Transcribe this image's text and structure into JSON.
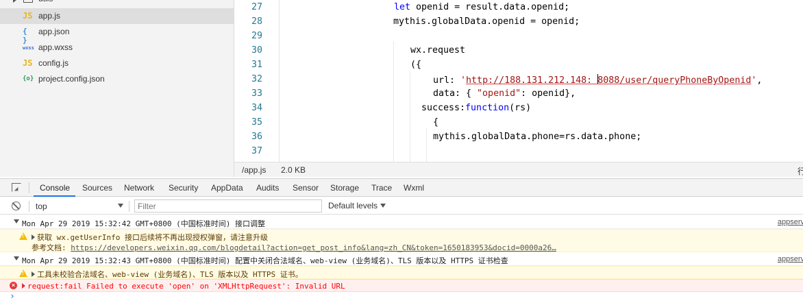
{
  "filetree": {
    "folder": {
      "label": "utils",
      "icon": "folder-icon"
    },
    "files": [
      {
        "name": "app.js",
        "icon": "JS",
        "type": "js",
        "active": true
      },
      {
        "name": "app.json",
        "icon": "{ }",
        "type": "json",
        "active": false
      },
      {
        "name": "app.wxss",
        "icon": "wxss",
        "type": "wxss",
        "active": false
      },
      {
        "name": "config.js",
        "icon": "JS",
        "type": "js",
        "active": false
      },
      {
        "name": "project.config.json",
        "icon": "{o}",
        "type": "cfg",
        "active": false
      }
    ]
  },
  "editor": {
    "line_numbers": [
      "27",
      "28",
      "29",
      "30",
      "31",
      "32",
      "33",
      "34",
      "35",
      "36",
      "37"
    ],
    "lines": {
      "l27_kw": "let",
      "l27_rest": " openid = result.data.openid;",
      "l28": "mythis.globalData.openid = openid;",
      "l30": "wx.request",
      "l31": "({",
      "l32_key": "url: ",
      "l32_q1": "'",
      "l32_url_a": "http://188.131.212.148: ",
      "l32_url_b": "8088/user/queryPhoneByOpenid",
      "l32_q2": "'",
      "l32_tail": ",",
      "l33_a": "data: { ",
      "l33_str": "\"openid\"",
      "l33_b": ": openid},",
      "l34_a": "success:",
      "l34_kw": "function",
      "l34_b": "(rs)",
      "l35": "{",
      "l36": "mythis.globalData.phone=rs.data.phone;"
    }
  },
  "statusbar": {
    "file": "/app.js",
    "size": "2.0 KB",
    "right": "行"
  },
  "devtools": {
    "tabs": [
      "Console",
      "Sources",
      "Network",
      "Security",
      "AppData",
      "Audits",
      "Sensor",
      "Storage",
      "Trace",
      "Wxml"
    ],
    "active_tab": "Console"
  },
  "console_toolbar": {
    "context": "top",
    "filter_placeholder": "Filter",
    "levels": "Default levels"
  },
  "messages": {
    "group1_title": "Mon Apr 29 2019 15:32:42 GMT+0800 (中国标准时间) 接口调整",
    "group1_source": "appserv",
    "warn1_line1": "获取 wx.getUserInfo 接口后续将不再出现授权弹窗，请注意升级",
    "warn1_doc_label": "参考文档: ",
    "warn1_doc_url": "https://developers.weixin.qq.com/blogdetail?action=get_post_info&lang=zh_CN&token=1650183953&docid=0000a26…",
    "group2_title": "Mon Apr 29 2019 15:32:43 GMT+0800 (中国标准时间) 配置中关闭合法域名、web-view (业务域名)、TLS 版本以及 HTTPS 证书检查",
    "group2_source": "appserv",
    "warn2_line1": "工具未校验合法域名、web-view (业务域名)、TLS 版本以及 HTTPS 证书。",
    "error_text": "request:fail Failed to execute 'open' on 'XMLHttpRequest': Invalid URL",
    "prompt": "›"
  }
}
